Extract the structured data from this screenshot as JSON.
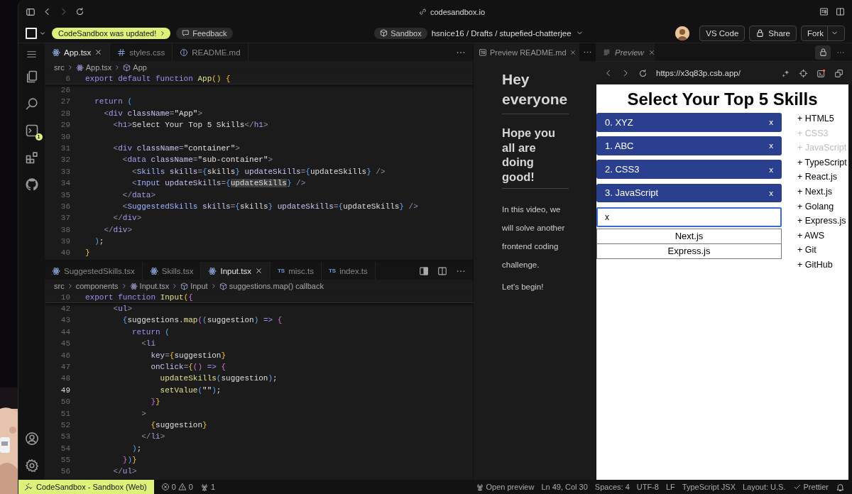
{
  "browser": {
    "address": "codesandbox.io"
  },
  "toolbar": {
    "update_notice": "CodeSandbox was updated!",
    "feedback": "Feedback",
    "sandbox_badge": "Sandbox",
    "path": "hsnice16 / Drafts / stupefied-chatterjee",
    "buttons": [
      {
        "label": "VS Code",
        "kind": "plain"
      },
      {
        "label": "Share",
        "kind": "lock"
      },
      {
        "label": "Fork",
        "kind": "split"
      }
    ]
  },
  "activity_bar": {
    "terminal_badge": "1"
  },
  "editors": [
    {
      "tabs": [
        {
          "label": "App.tsx",
          "kind": "react",
          "selected": true
        },
        {
          "label": "styles.css",
          "kind": "css",
          "selected": false
        },
        {
          "label": "README.md",
          "kind": "info",
          "selected": false
        }
      ],
      "breadcrumb": [
        {
          "label": "src",
          "kind": "folder"
        },
        {
          "label": "App.tsx",
          "kind": "react"
        },
        {
          "label": "App",
          "kind": "cube"
        }
      ],
      "sticky": {
        "num": "6",
        "tokens": [
          {
            "text": "export default function ",
            "kind": "kw"
          },
          {
            "text": "App",
            "kind": "fn"
          },
          {
            "text": "() {",
            "kind": "b1"
          }
        ]
      },
      "lines": [
        {
          "num": "26",
          "current": false
        },
        {
          "num": "27",
          "current": false,
          "tokens": [
            {
              "text": "  return ",
              "kind": "kw"
            },
            {
              "text": "(",
              "kind": "b3"
            }
          ]
        },
        {
          "num": "28",
          "current": false,
          "tokens": [
            {
              "text": "    <",
              "kind": "tp"
            },
            {
              "text": "div ",
              "kind": "tag"
            },
            {
              "text": "className",
              "kind": "attr"
            },
            {
              "text": "=",
              "kind": "tp"
            },
            {
              "text": "\"App\"",
              "kind": "str"
            },
            {
              "text": ">",
              "kind": "tp"
            }
          ]
        },
        {
          "num": "29",
          "current": false,
          "tokens": [
            {
              "text": "      <",
              "kind": "tp"
            },
            {
              "text": "h1",
              "kind": "tag"
            },
            {
              "text": ">",
              "kind": "tp"
            },
            {
              "text": "Select Your Top 5 Skills",
              "kind": "txt"
            },
            {
              "text": "</",
              "kind": "tp"
            },
            {
              "text": "h1",
              "kind": "tag"
            },
            {
              "text": ">",
              "kind": "tp"
            }
          ]
        },
        {
          "num": "30",
          "current": false
        },
        {
          "num": "31",
          "current": false,
          "tokens": [
            {
              "text": "      <",
              "kind": "tp"
            },
            {
              "text": "div ",
              "kind": "tag"
            },
            {
              "text": "className",
              "kind": "attr"
            },
            {
              "text": "=",
              "kind": "tp"
            },
            {
              "text": "\"container\"",
              "kind": "str"
            },
            {
              "text": ">",
              "kind": "tp"
            }
          ]
        },
        {
          "num": "32",
          "current": false,
          "tokens": [
            {
              "text": "        <",
              "kind": "tp"
            },
            {
              "text": "data ",
              "kind": "tag"
            },
            {
              "text": "className",
              "kind": "attr"
            },
            {
              "text": "=",
              "kind": "tp"
            },
            {
              "text": "\"sub-container\"",
              "kind": "str"
            },
            {
              "text": ">",
              "kind": "tp"
            }
          ]
        },
        {
          "num": "33",
          "current": false,
          "tokens": [
            {
              "text": "          <",
              "kind": "tp"
            },
            {
              "text": "Skills ",
              "kind": "comp"
            },
            {
              "text": "skills",
              "kind": "attr"
            },
            {
              "text": "=",
              "kind": "tp"
            },
            {
              "text": "{",
              "kind": "b3"
            },
            {
              "text": "skills",
              "kind": "txt"
            },
            {
              "text": "} ",
              "kind": "b3"
            },
            {
              "text": "updateSkills",
              "kind": "attr"
            },
            {
              "text": "=",
              "kind": "tp"
            },
            {
              "text": "{",
              "kind": "b3"
            },
            {
              "text": "updateSkills",
              "kind": "txt"
            },
            {
              "text": "} ",
              "kind": "b3"
            },
            {
              "text": "/>",
              "kind": "tp"
            }
          ]
        },
        {
          "num": "34",
          "current": false,
          "tokens": [
            {
              "text": "          <",
              "kind": "tp"
            },
            {
              "text": "Input ",
              "kind": "comp"
            },
            {
              "text": "updateSkills",
              "kind": "attr"
            },
            {
              "text": "=",
              "kind": "tp"
            },
            {
              "text": "{",
              "kind": "b3"
            },
            {
              "text": "updateSkills",
              "kind": "match"
            },
            {
              "text": "}",
              "kind": "b3"
            },
            {
              "text": " />",
              "kind": "tp"
            }
          ]
        },
        {
          "num": "35",
          "current": false,
          "tokens": [
            {
              "text": "        </",
              "kind": "tp"
            },
            {
              "text": "data",
              "kind": "tag"
            },
            {
              "text": ">",
              "kind": "tp"
            }
          ]
        },
        {
          "num": "36",
          "current": false,
          "tokens": [
            {
              "text": "        <",
              "kind": "tp"
            },
            {
              "text": "SuggestedSkills ",
              "kind": "comp"
            },
            {
              "text": "skills",
              "kind": "attr"
            },
            {
              "text": "=",
              "kind": "tp"
            },
            {
              "text": "{",
              "kind": "b3"
            },
            {
              "text": "skills",
              "kind": "txt"
            },
            {
              "text": "} ",
              "kind": "b3"
            },
            {
              "text": "updateSkills",
              "kind": "attr"
            },
            {
              "text": "=",
              "kind": "tp"
            },
            {
              "text": "{",
              "kind": "b3"
            },
            {
              "text": "updateSkills",
              "kind": "txt"
            },
            {
              "text": "} ",
              "kind": "b3"
            },
            {
              "text": "/>",
              "kind": "tp"
            }
          ]
        },
        {
          "num": "37",
          "current": false,
          "tokens": [
            {
              "text": "      </",
              "kind": "tp"
            },
            {
              "text": "div",
              "kind": "tag"
            },
            {
              "text": ">",
              "kind": "tp"
            }
          ]
        },
        {
          "num": "38",
          "current": false,
          "tokens": [
            {
              "text": "    </",
              "kind": "tp"
            },
            {
              "text": "div",
              "kind": "tag"
            },
            {
              "text": ">",
              "kind": "tp"
            }
          ]
        },
        {
          "num": "39",
          "current": false,
          "tokens": [
            {
              "text": "  )",
              "kind": "b3"
            },
            {
              "text": ";",
              "kind": "txt"
            }
          ]
        },
        {
          "num": "40",
          "current": false,
          "tokens": [
            {
              "text": "}",
              "kind": "b1"
            }
          ]
        }
      ]
    },
    {
      "tabs": [
        {
          "label": "SuggestedSkills.tsx",
          "kind": "react",
          "selected": false
        },
        {
          "label": "Skills.tsx",
          "kind": "react",
          "selected": false
        },
        {
          "label": "Input.tsx",
          "kind": "react",
          "selected": true
        },
        {
          "label": "misc.ts",
          "kind": "ts",
          "badge": "TS",
          "selected": false
        },
        {
          "label": "index.ts",
          "kind": "ts",
          "badge": "TS",
          "selected": false
        }
      ],
      "breadcrumb": [
        {
          "label": "src",
          "kind": "folder"
        },
        {
          "label": "components",
          "kind": "folder"
        },
        {
          "label": "Input.tsx",
          "kind": "react"
        },
        {
          "label": "Input",
          "kind": "cube"
        },
        {
          "label": "suggestions.map() callback",
          "kind": "cube"
        }
      ],
      "sticky": {
        "num": "10",
        "tokens": [
          {
            "text": "export function ",
            "kind": "kw"
          },
          {
            "text": "Input",
            "kind": "fn"
          },
          {
            "text": "(",
            "kind": "b1"
          },
          {
            "text": "{",
            "kind": "b2"
          }
        ]
      },
      "lines": [
        {
          "num": "42",
          "current": false,
          "tokens": [
            {
              "text": "      <",
              "kind": "tp"
            },
            {
              "text": "ul",
              "kind": "tag"
            },
            {
              "text": ">",
              "kind": "tp"
            }
          ]
        },
        {
          "num": "43",
          "current": false,
          "tokens": [
            {
              "text": "        {",
              "kind": "b3"
            },
            {
              "text": "suggestions.",
              "kind": "txt"
            },
            {
              "text": "map",
              "kind": "fn"
            },
            {
              "text": "(",
              "kind": "b2"
            },
            {
              "text": "(",
              "kind": "b3"
            },
            {
              "text": "suggestion",
              "kind": "txt"
            },
            {
              "text": ") ",
              "kind": "b3"
            },
            {
              "text": "=> ",
              "kind": "kw"
            },
            {
              "text": "{",
              "kind": "b2"
            }
          ]
        },
        {
          "num": "44",
          "current": false,
          "tokens": [
            {
              "text": "          return ",
              "kind": "kw"
            },
            {
              "text": "(",
              "kind": "b3"
            }
          ]
        },
        {
          "num": "45",
          "current": false,
          "tokens": [
            {
              "text": "            <",
              "kind": "tp"
            },
            {
              "text": "li",
              "kind": "tag"
            }
          ]
        },
        {
          "num": "46",
          "current": false,
          "tokens": [
            {
              "text": "              key",
              "kind": "attr"
            },
            {
              "text": "=",
              "kind": "tp"
            },
            {
              "text": "{",
              "kind": "b1"
            },
            {
              "text": "suggestion",
              "kind": "txt"
            },
            {
              "text": "}",
              "kind": "b1"
            }
          ]
        },
        {
          "num": "47",
          "current": false,
          "tokens": [
            {
              "text": "              onClick",
              "kind": "attr"
            },
            {
              "text": "=",
              "kind": "tp"
            },
            {
              "text": "{",
              "kind": "b1"
            },
            {
              "text": "() ",
              "kind": "b2"
            },
            {
              "text": "=> ",
              "kind": "kw"
            },
            {
              "text": "{",
              "kind": "b2"
            }
          ]
        },
        {
          "num": "48",
          "current": false,
          "tokens": [
            {
              "text": "                updateSkills",
              "kind": "fn"
            },
            {
              "text": "(",
              "kind": "b3"
            },
            {
              "text": "suggestion",
              "kind": "txt"
            },
            {
              "text": ")",
              "kind": "b3"
            },
            {
              "text": ";",
              "kind": "txt"
            }
          ]
        },
        {
          "num": "49",
          "current": true,
          "tokens": [
            {
              "text": "                setValue",
              "kind": "fn"
            },
            {
              "text": "(",
              "kind": "b3"
            },
            {
              "text": "\"\"",
              "kind": "str"
            },
            {
              "text": ")",
              "kind": "b3"
            },
            {
              "text": ";",
              "kind": "txt"
            }
          ]
        },
        {
          "num": "50",
          "current": false,
          "tokens": [
            {
              "text": "              }",
              "kind": "b2"
            },
            {
              "text": "}",
              "kind": "b1"
            }
          ]
        },
        {
          "num": "51",
          "current": false,
          "tokens": [
            {
              "text": "            >",
              "kind": "tp"
            }
          ]
        },
        {
          "num": "52",
          "current": false,
          "tokens": [
            {
              "text": "              {",
              "kind": "b1"
            },
            {
              "text": "suggestion",
              "kind": "txt"
            },
            {
              "text": "}",
              "kind": "b1"
            }
          ]
        },
        {
          "num": "53",
          "current": false,
          "tokens": [
            {
              "text": "            </",
              "kind": "tp"
            },
            {
              "text": "li",
              "kind": "tag"
            },
            {
              "text": ">",
              "kind": "tp"
            }
          ]
        },
        {
          "num": "54",
          "current": false,
          "tokens": [
            {
              "text": "          )",
              "kind": "b3"
            },
            {
              "text": ";",
              "kind": "txt"
            }
          ]
        },
        {
          "num": "55",
          "current": false,
          "tokens": [
            {
              "text": "        }",
              "kind": "b2"
            },
            {
              "text": ")",
              "kind": "b3"
            },
            {
              "text": "}",
              "kind": "b1"
            }
          ]
        },
        {
          "num": "56",
          "current": false,
          "tokens": [
            {
              "text": "      </",
              "kind": "tp"
            },
            {
              "text": "ul",
              "kind": "tag"
            },
            {
              "text": ">",
              "kind": "tp"
            }
          ]
        }
      ]
    }
  ],
  "readme_preview": {
    "tab": "Preview README.md",
    "heading": "Hey everyone",
    "subheading": "Hope you all are doing good!",
    "paragraphs": [
      "In this video, we will solve another frontend coding challenge.",
      "Let's begin!"
    ]
  },
  "preview": {
    "tab": "Preview",
    "url": "https://x3q83p.csb.app/",
    "page": {
      "title": "Select Your Top 5 Skills",
      "skills": [
        {
          "label": "0. XYZ",
          "remove": "x"
        },
        {
          "label": "1. ABC",
          "remove": "x"
        },
        {
          "label": "2. CSS3",
          "remove": "x"
        },
        {
          "label": "3. JavaScript",
          "remove": "x"
        }
      ],
      "input_value": "x",
      "suggestions": [
        "Next.js",
        "Express.js"
      ],
      "suggested": [
        {
          "label": "+ HTML5",
          "disabled": false
        },
        {
          "label": "+ CSS3",
          "disabled": true
        },
        {
          "label": "+ JavaScript",
          "disabled": true
        },
        {
          "label": "+ TypeScript",
          "disabled": false
        },
        {
          "label": "+ React.js",
          "disabled": false
        },
        {
          "label": "+ Next.js",
          "disabled": false
        },
        {
          "label": "+ Golang",
          "disabled": false
        },
        {
          "label": "+ Express.js",
          "disabled": false
        },
        {
          "label": "+ AWS",
          "disabled": false
        },
        {
          "label": "+ Git",
          "disabled": false
        },
        {
          "label": "+ GitHub",
          "disabled": false
        }
      ]
    }
  },
  "status_bar": {
    "remote": "CodeSandbox - Sandbox (Web)",
    "errors": "0",
    "warnings": "0",
    "ports": "1",
    "items": [
      {
        "text": "Open preview",
        "kind": "antenna"
      },
      {
        "text": "Ln 49, Col 30",
        "kind": "plain"
      },
      {
        "text": "Spaces: 4",
        "kind": "plain"
      },
      {
        "text": "UTF-8",
        "kind": "plain"
      },
      {
        "text": "LF",
        "kind": "plain"
      },
      {
        "text": "TypeScript JSX",
        "kind": "plain"
      },
      {
        "text": "Layout: U.S.",
        "kind": "plain"
      },
      {
        "text": "Prettier",
        "kind": "check"
      }
    ]
  }
}
